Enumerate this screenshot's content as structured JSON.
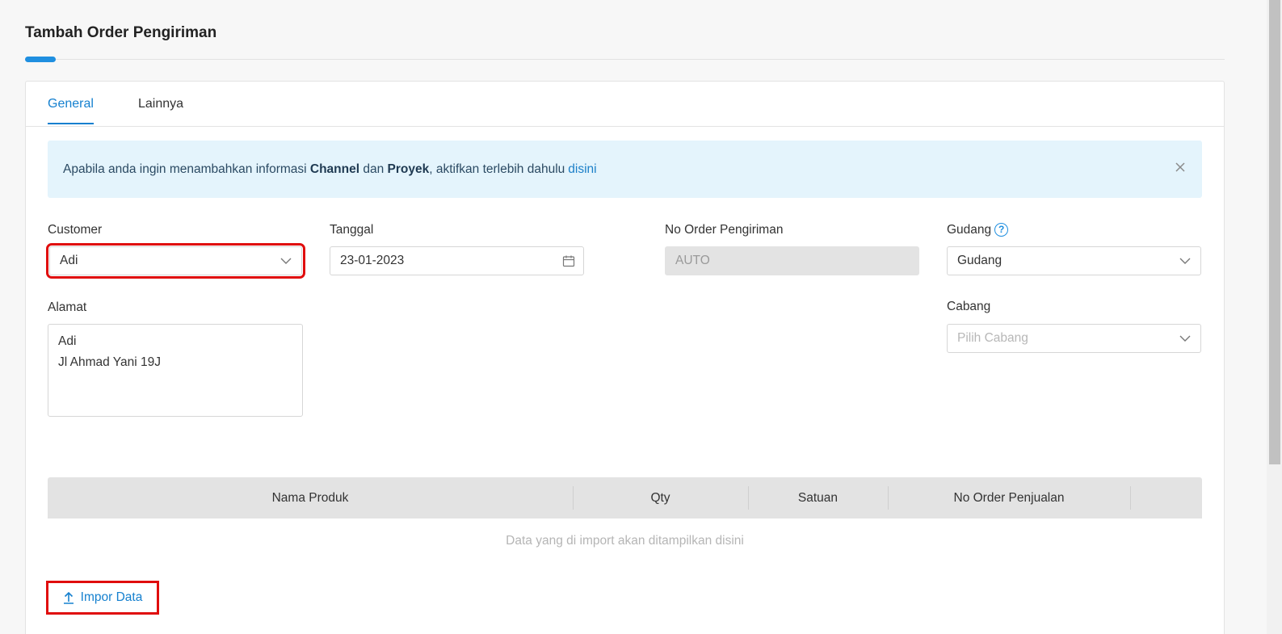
{
  "page": {
    "title": "Tambah Order Pengiriman"
  },
  "tabs": [
    {
      "label": "General",
      "active": true
    },
    {
      "label": "Lainnya",
      "active": false
    }
  ],
  "alert": {
    "text_prefix": "Apabila anda ingin menambahkan informasi",
    "bold1": "Channel",
    "text_mid": "dan",
    "bold2": "Proyek",
    "text_suffix": ", aktifkan terlebih dahulu",
    "link": "disini"
  },
  "form": {
    "customer": {
      "label": "Customer",
      "value": "Adi"
    },
    "tanggal": {
      "label": "Tanggal",
      "value": "23-01-2023"
    },
    "no_order": {
      "label": "No Order Pengiriman",
      "value": "AUTO"
    },
    "gudang": {
      "label": "Gudang",
      "value": "Gudang"
    },
    "alamat": {
      "label": "Alamat",
      "line1": "Adi",
      "line2": "Jl Ahmad Yani 19J"
    },
    "cabang": {
      "label": "Cabang",
      "placeholder": "Pilih Cabang"
    }
  },
  "table": {
    "columns": [
      "Nama Produk",
      "Qty",
      "Satuan",
      "No Order Penjualan"
    ],
    "empty_message": "Data yang di import akan ditampilkan disini"
  },
  "actions": {
    "import_label": "Impor Data"
  },
  "colors": {
    "accent": "#1580cf",
    "highlight": "#e00d0d",
    "alert_bg": "#e4f4fc"
  }
}
